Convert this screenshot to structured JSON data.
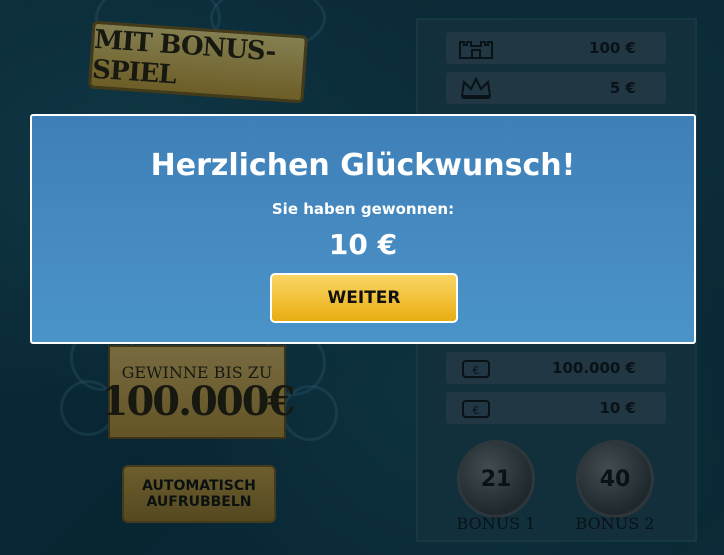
{
  "game": {
    "banner_text": "MIT BONUS-SPIEL",
    "max_win": {
      "line1": "GEWINNE BIS ZU",
      "line2": "100.000€"
    },
    "auto_button": {
      "line1": "AUTOMATISCH",
      "line2": "AUFRUBBELN"
    }
  },
  "paytable": {
    "rows": [
      {
        "icon": "castle-icon",
        "value": "100 €"
      },
      {
        "icon": "crown-icon",
        "value": "5 €"
      },
      {
        "icon": "wallet-icon",
        "value": "100.000 €"
      },
      {
        "icon": "wallet-icon",
        "value": "10 €"
      }
    ]
  },
  "bonus": [
    {
      "number": "21",
      "label": "BONUS 1"
    },
    {
      "number": "40",
      "label": "BONUS 2"
    }
  ],
  "modal": {
    "title": "Herzlichen Glückwunsch!",
    "subtitle": "Sie haben gewonnen:",
    "amount": "10 €",
    "button_label": "WEITER"
  },
  "colors": {
    "modal_bg": "#4a94c8",
    "button": "#f5c33a",
    "gold": "#c79a2e"
  }
}
